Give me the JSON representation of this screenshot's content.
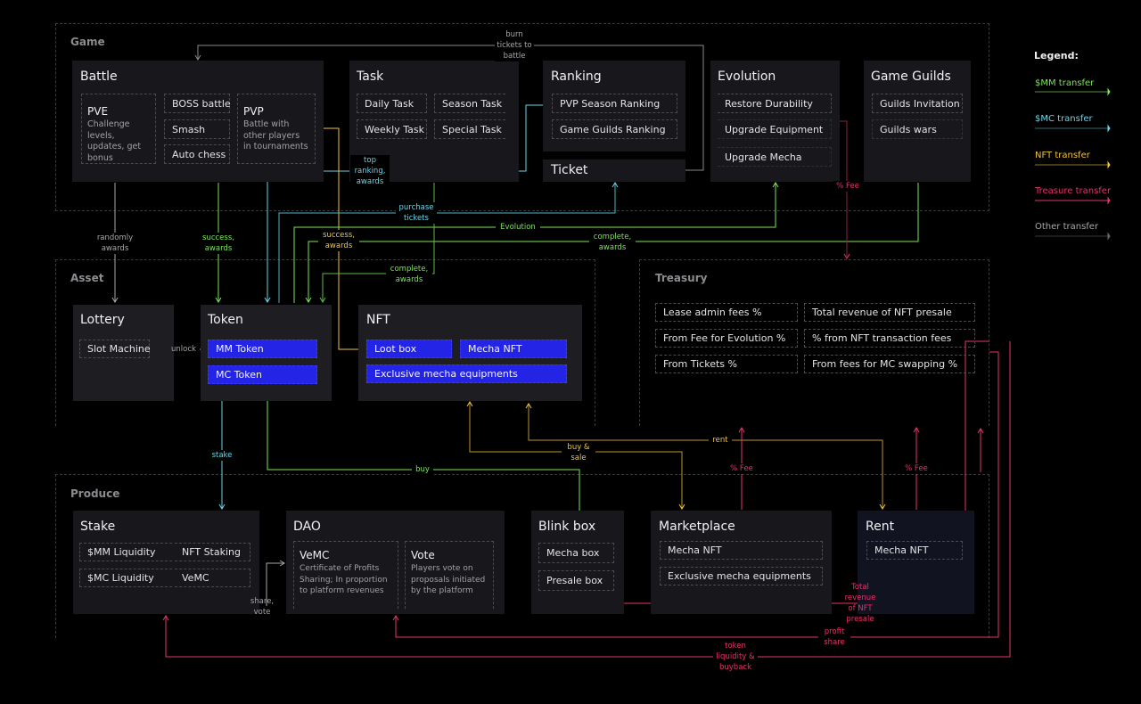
{
  "sections": {
    "game": "Game",
    "asset": "Asset",
    "treasury": "Treasury",
    "produce": "Produce"
  },
  "game": {
    "battle": {
      "title": "Battle",
      "pve": {
        "title": "PVE",
        "desc": "Challenge levels, updates, get bonus"
      },
      "modes": [
        "BOSS battle",
        "Smash",
        "Auto chess"
      ],
      "pvp": {
        "title": "PVP",
        "desc": "Battle with other players in tournaments"
      }
    },
    "task": {
      "title": "Task",
      "items": [
        "Daily Task",
        "Season Task",
        "Weekly Task",
        "Special Task"
      ]
    },
    "ranking": {
      "title": "Ranking",
      "items": [
        "PVP Season Ranking",
        "Game Guilds Ranking"
      ]
    },
    "ticket": {
      "title": "Ticket"
    },
    "evolution": {
      "title": "Evolution",
      "items": [
        "Restore Durability",
        "Upgrade Equipment",
        "Upgrade Mecha"
      ]
    },
    "guilds": {
      "title": "Game Guilds",
      "items": [
        "Guilds Invitation",
        "Guilds wars"
      ]
    }
  },
  "asset": {
    "lottery": {
      "title": "Lottery",
      "items": [
        "Slot Machine"
      ]
    },
    "token": {
      "title": "Token",
      "items": [
        "MM Token",
        "MC Token"
      ]
    },
    "nft": {
      "title": "NFT",
      "items": [
        "Loot box",
        "Mecha NFT",
        "Exclusive mecha equipments"
      ]
    }
  },
  "treasury": {
    "items": [
      "Lease admin fees %",
      "Total revenue of NFT presale",
      "From Fee for Evolution %",
      "% from NFT transaction fees",
      "From Tickets %",
      "From fees for MC swapping %"
    ]
  },
  "produce": {
    "stake": {
      "title": "Stake",
      "items": [
        "$MM Liquidity",
        "NFT Staking",
        "$MC Liquidity",
        "VeMC"
      ]
    },
    "dao": {
      "title": "DAO",
      "vemc": {
        "title": "VeMC",
        "desc": "Certificate of Profits Sharing; In proportion to platform revenues"
      },
      "vote": {
        "title": "Vote",
        "desc": "Players vote on proposals initiated by the platform"
      }
    },
    "blinkbox": {
      "title": "Blink box",
      "items": [
        "Mecha box",
        "Presale box"
      ]
    },
    "marketplace": {
      "title": "Marketplace",
      "items": [
        "Mecha NFT",
        "Exclusive mecha equipments"
      ]
    },
    "rent": {
      "title": "Rent",
      "items": [
        "Mecha NFT"
      ]
    }
  },
  "flow_labels": {
    "burn_tickets": "burn\ntickets to\nbattle",
    "top_ranking": "top\nranking,\nawards",
    "randomly_awards": "randomly\nawards",
    "success_awards_mm": "success,\nawards",
    "purchase_tickets": "purchase\ntickets",
    "evolution": "Evolution",
    "success_awards_nft": "success,\nawards",
    "complete_awards_guild": "complete,\nawards",
    "complete_awards_task": "complete,\nawards",
    "fee_evolution": "% Fee",
    "unlock": "unlock",
    "stake": "stake",
    "buy": "buy",
    "buy_sale": "buy &\nsale",
    "rent": "rent",
    "fee_market": "% Fee",
    "fee_rent": "% Fee",
    "share_vote": "share,\nvote",
    "total_revenue_presale": "Total\nrevenue\nof NFT\npresale",
    "profit_share": "profit\nshare",
    "token_liquidity": "token\nliquidity &\nbuyback"
  },
  "legend": {
    "title": "Legend:",
    "items": [
      {
        "label": "$MM transfer",
        "color": "#7be35a"
      },
      {
        "label": "$MC transfer",
        "color": "#6dd3e6"
      },
      {
        "label": "NFT transfer",
        "color": "#f0c53c"
      },
      {
        "label": "Treasure transfer",
        "color": "#e6336a"
      },
      {
        "label": "Other transfer",
        "color": "#a8a8ac"
      }
    ]
  },
  "colors": {
    "mm": "#7be35a",
    "mc": "#6dd3e6",
    "nft": "#f0c53c",
    "treasure": "#e6336a",
    "other": "#a8a8ac",
    "token_chip": "#2424e6"
  }
}
